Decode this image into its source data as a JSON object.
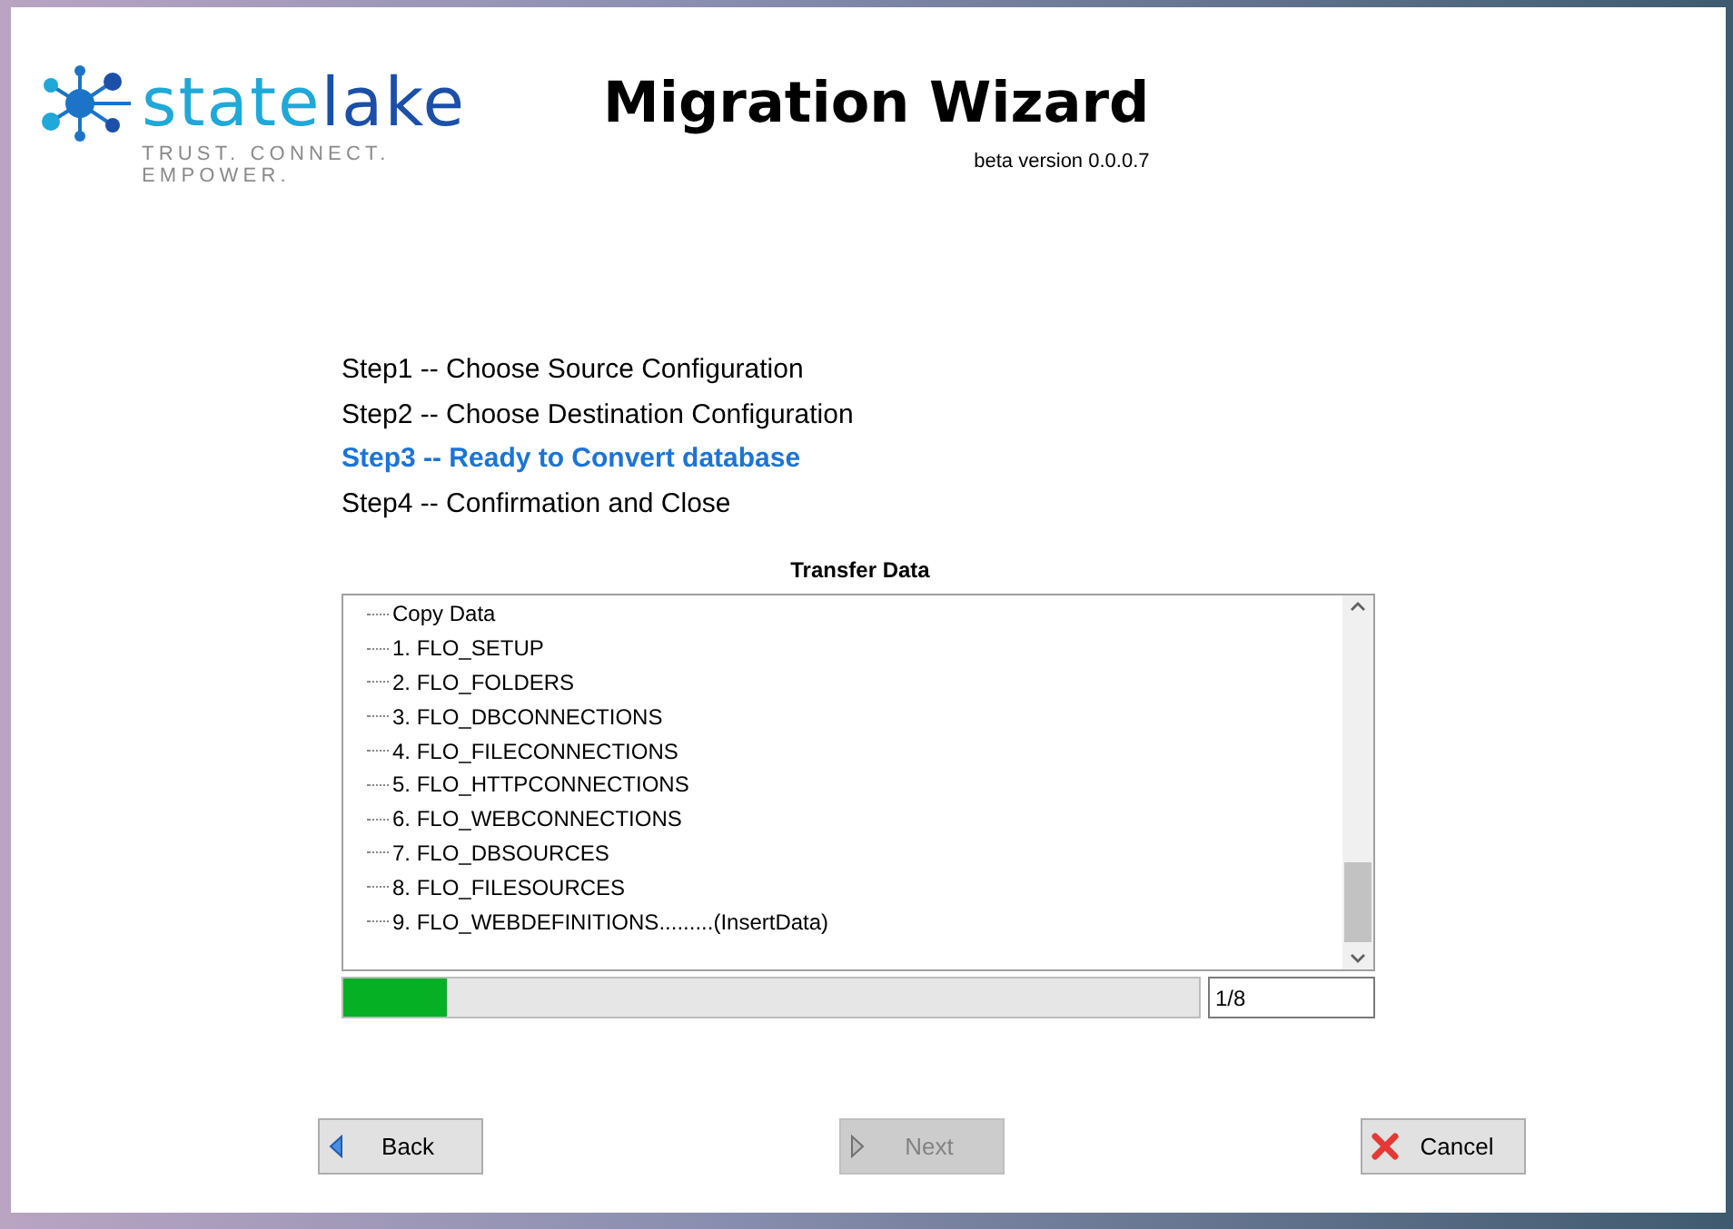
{
  "logo": {
    "name_part1": "state",
    "name_part2": "lake",
    "tagline": "TRUST. CONNECT. EMPOWER."
  },
  "header": {
    "title": "Migration Wizard",
    "version": "beta version 0.0.0.7"
  },
  "steps": [
    {
      "label": "Step1 -- Choose Source Configuration",
      "selected": false
    },
    {
      "label": "Step2 -- Choose Destination Configuration",
      "selected": false
    },
    {
      "label": "Step3 -- Ready to Convert database",
      "selected": true
    },
    {
      "label": "Step4 -- Confirmation and Close",
      "selected": false
    }
  ],
  "transfer": {
    "title": "Transfer Data",
    "items": [
      "Copy Data",
      "1. FLO_SETUP",
      "2. FLO_FOLDERS",
      "3. FLO_DBCONNECTIONS",
      "4. FLO_FILECONNECTIONS",
      "5. FLO_HTTPCONNECTIONS",
      "6. FLO_WEBCONNECTIONS",
      "7. FLO_DBSOURCES",
      "8. FLO_FILESOURCES",
      "9. FLO_WEBDEFINITIONS.........(InsertData)"
    ],
    "progress": {
      "level": 0.12
    },
    "counter": "1/8"
  },
  "buttons": [
    {
      "kind": "back",
      "label": "Back",
      "disabled": false
    },
    {
      "kind": "next",
      "label": "Next",
      "disabled": true
    },
    {
      "kind": "cancel",
      "label": "Cancel",
      "disabled": false
    }
  ]
}
